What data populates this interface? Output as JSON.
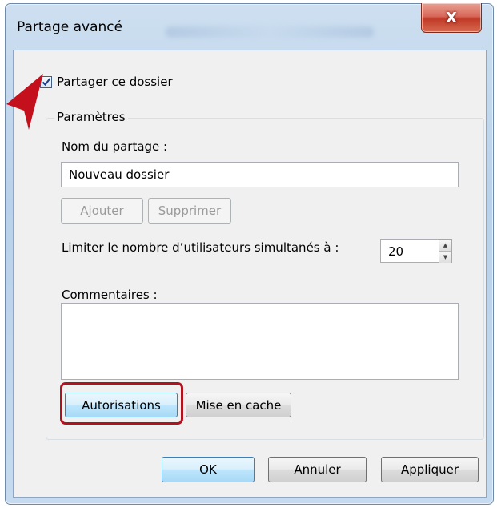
{
  "window": {
    "title": "Partage avancé",
    "close_glyph": "X"
  },
  "share": {
    "checkbox_label": "Partager ce dossier",
    "checked": true
  },
  "settings": {
    "group_label": "Paramètres",
    "share_name_label": "Nom du partage :",
    "share_name_value": "Nouveau dossier",
    "add_label": "Ajouter",
    "remove_label": "Supprimer",
    "limit_label": "Limiter le nombre d’utilisateurs simultanés à :",
    "limit_value": "20",
    "comments_label": "Commentaires :",
    "comments_value": "",
    "permissions_label": "Autorisations",
    "caching_label": "Mise en cache"
  },
  "footer": {
    "ok_label": "OK",
    "cancel_label": "Annuler",
    "apply_label": "Appliquer"
  },
  "colors": {
    "highlight": "#b0121e",
    "annotation_arrow": "#c4101c"
  },
  "icons": {
    "check": "checkmark-icon",
    "spin_up": "triangle-up-icon",
    "spin_down": "triangle-down-icon",
    "arrow": "annotation-arrow-icon"
  }
}
